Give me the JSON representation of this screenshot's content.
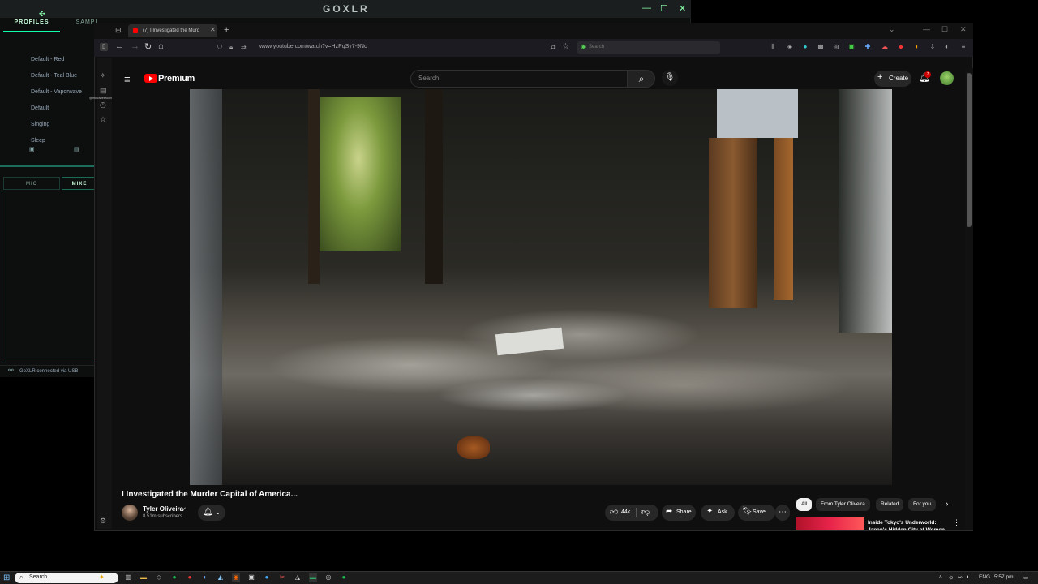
{
  "goxlr": {
    "title": "GOXLR",
    "tabs": {
      "profiles": "PROFILES",
      "samples": "SAMPL"
    },
    "profiles": [
      "Default - Red",
      "Default - Teal Blue",
      "Default - Vaporwave",
      "Default",
      "Singing",
      "Sleep"
    ],
    "lower_tabs": {
      "mic": "MIC",
      "mixer": "MIXE"
    },
    "status": "GoXLR connected via USB"
  },
  "browser": {
    "tab_title": "(7) I Investigated the Murd",
    "url": "www.youtube.com/watch?v=HzPqSy7-9No",
    "search_placeholder": "Search",
    "sidebar_label": "@mindwebtoon"
  },
  "youtube": {
    "logo": "Premium",
    "search_placeholder": "Search",
    "create_label": "Create",
    "notification_count": "7",
    "video_title": "I Investigated the Murder Capital of America...",
    "channel": {
      "name": "Tyler Oliveira",
      "verified": "✔",
      "subscribers": "8.51m subscribers"
    },
    "actions": {
      "likes": "44k",
      "share": "Share",
      "ask": "Ask",
      "save": "Save"
    },
    "chips": [
      "All",
      "From Tyler Oliveira",
      "Related",
      "For you"
    ],
    "recommendation": {
      "title": "Inside Tokyo's Underworld: Japan's Hidden City of Women"
    }
  },
  "taskbar": {
    "search_text": "Search",
    "language": "ENG",
    "time": "5:57 pm"
  },
  "colors": {
    "goxlr_accent": "#1fa88a",
    "youtube_red": "#ff0000",
    "chip_active": "#f1f1f1"
  },
  "icons": [
    "hamburger-icon",
    "search-icon",
    "mic-icon",
    "bell-icon",
    "like-icon",
    "dislike-icon",
    "share-icon",
    "ask-icon",
    "save-icon",
    "more-icon"
  ]
}
